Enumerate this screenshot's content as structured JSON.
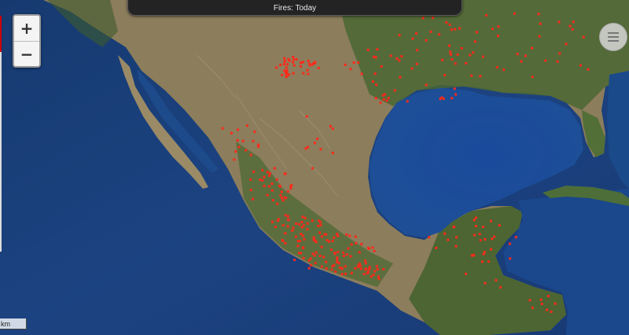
{
  "title_bar": {
    "label": "Fires: Today"
  },
  "zoom": {
    "in_label": "+",
    "out_label": "−"
  },
  "menu": {
    "icon": "hamburger-menu-icon"
  },
  "scale_bar": {
    "label": "km"
  },
  "colors": {
    "ocean": "#1d3f78",
    "deep_ocean": "#0d2a5c",
    "land_desert": "#9a8a66",
    "land_green": "#47622f",
    "fire": "#ff2a1a"
  }
}
